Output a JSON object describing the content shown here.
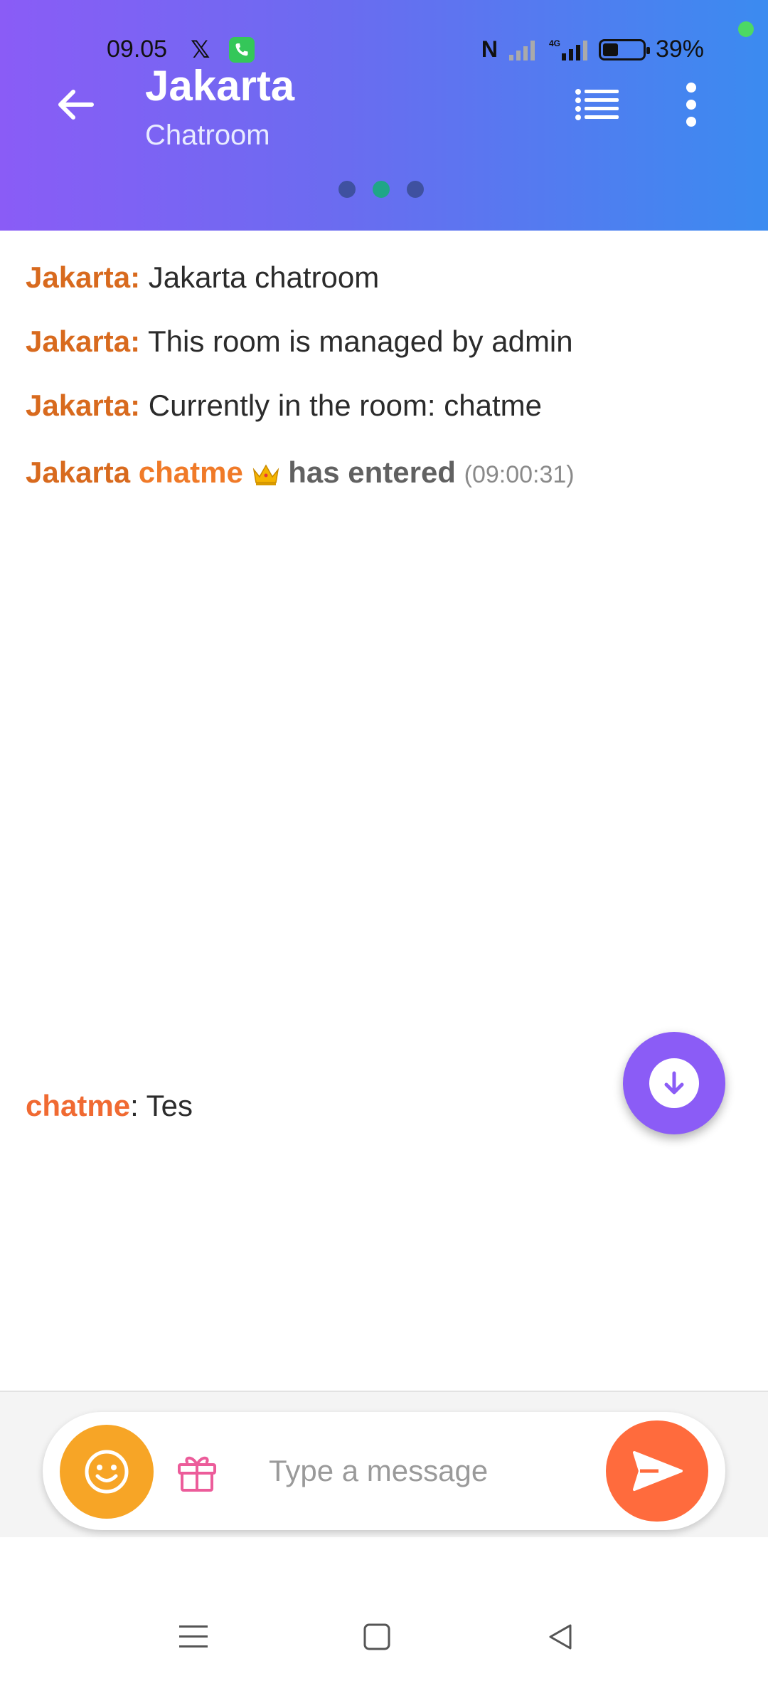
{
  "status_bar": {
    "time": "09.05",
    "x_glyph": "𝕏",
    "battery_pct": "39%",
    "battery_level": 0.39,
    "network": "4G"
  },
  "header": {
    "title": "Jakarta",
    "subtitle": "Chatroom",
    "page_indicator": {
      "count": 3,
      "active_index": 1
    },
    "colors": {
      "gradient_start": "#8a5cf6",
      "gradient_end": "#3b8bf0"
    }
  },
  "messages": [
    {
      "sender": "Jakarta:",
      "text": " Jakarta chatroom"
    },
    {
      "sender": "Jakarta:",
      "text": " This room is managed by admin"
    },
    {
      "sender": "Jakarta:",
      "text": " Currently in the room: chatme"
    }
  ],
  "join_event": {
    "room": "Jakarta",
    "user": "chatme",
    "badge_icon": "crown-icon",
    "action": "has entered",
    "time": "(09:00:31)"
  },
  "chat_message": {
    "user": "chatme",
    "separator": ":",
    "text": " Tes"
  },
  "composer": {
    "placeholder": "Type a message",
    "value": "",
    "emoji_icon": "smiley-icon",
    "gift_icon": "gift-icon",
    "send_icon": "send-icon",
    "colors": {
      "emoji": "#f7a526",
      "send": "#ff6b3d",
      "fab": "#8b5cf6"
    }
  },
  "nav": {
    "icons": [
      "menu-icon",
      "home-square-icon",
      "back-triangle-icon"
    ]
  }
}
